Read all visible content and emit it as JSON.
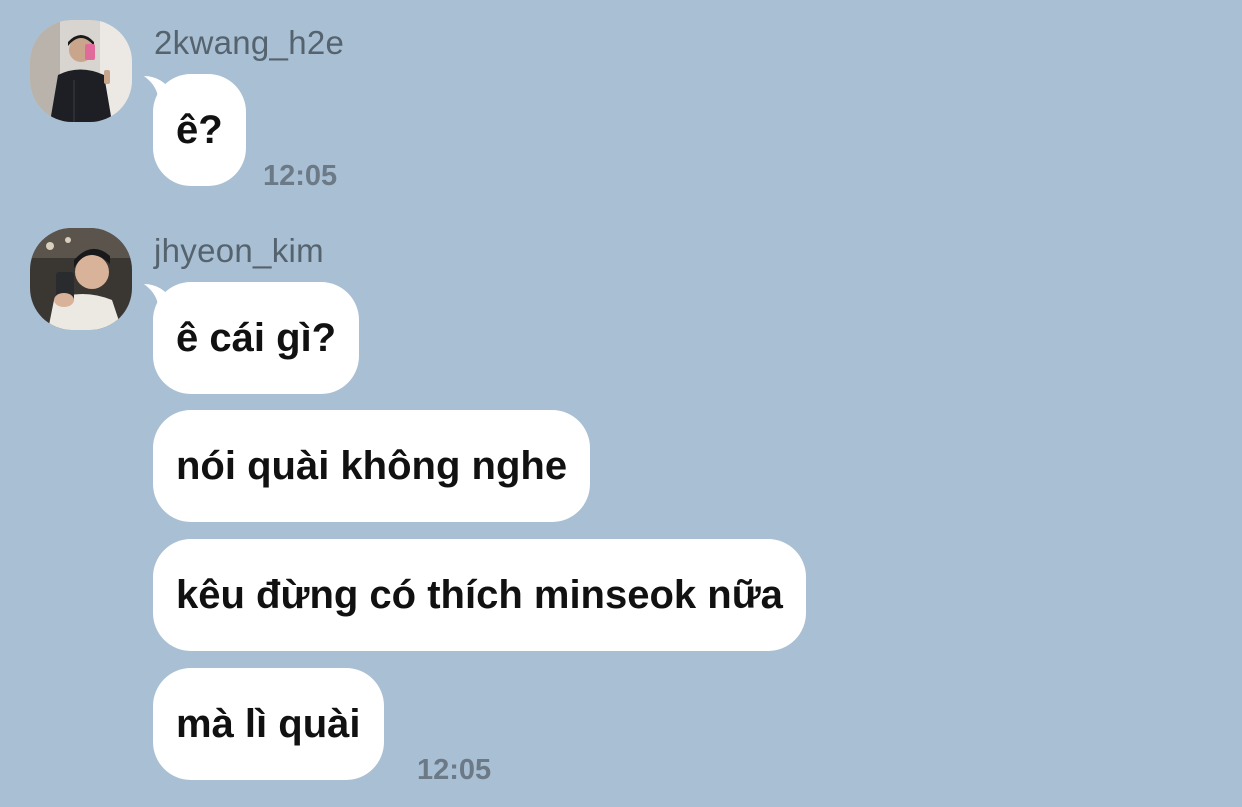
{
  "colors": {
    "background": "#a9bfd3",
    "bubble": "#ffffff",
    "username_text": "#55636f",
    "timestamp_text": "#6b7a86",
    "message_text": "#111111"
  },
  "messages": [
    {
      "username": "2kwang_h2e",
      "avatar": "profile-photo-icon",
      "bubbles": [
        "ê?"
      ],
      "time": "12:05"
    },
    {
      "username": "jhyeon_kim",
      "avatar": "profile-photo-icon",
      "bubbles": [
        "ê cái gì?",
        "nói quài không nghe",
        "kêu đừng có thích minseok nữa",
        "mà lì quài"
      ],
      "time": "12:05"
    }
  ]
}
